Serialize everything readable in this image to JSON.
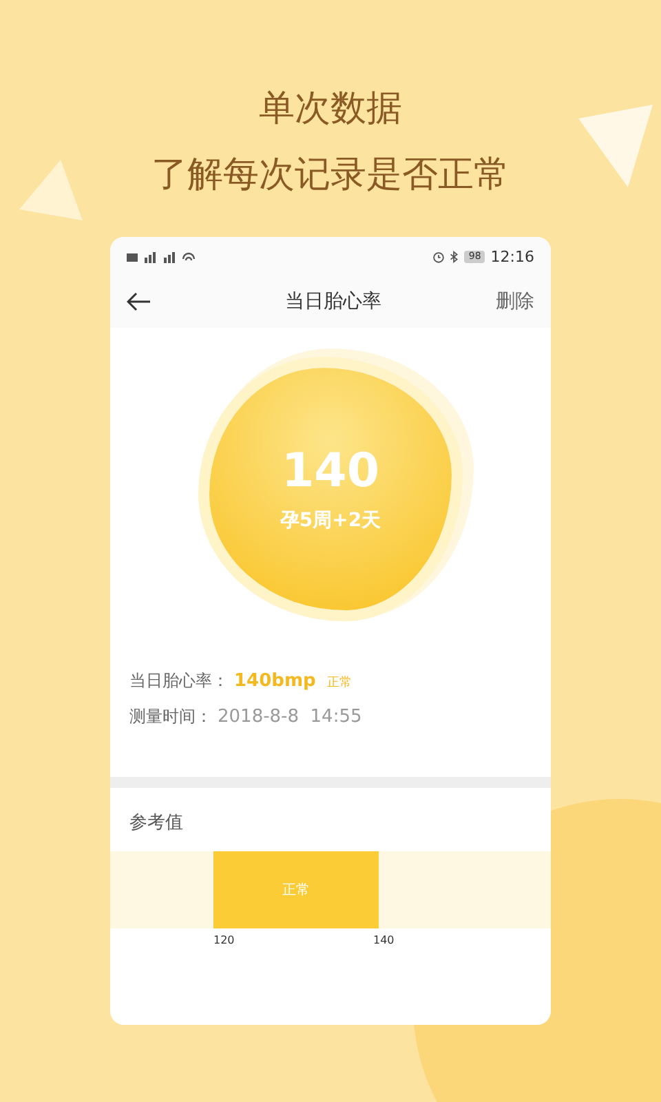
{
  "headline": [
    "单次数据",
    "了解每次记录是否正常"
  ],
  "status_bar": {
    "battery": "98",
    "time": "12:16"
  },
  "nav": {
    "title": "当日胎心率",
    "action": "删除"
  },
  "reading": {
    "value": "140",
    "gestation": "孕5周+2天"
  },
  "details": [
    {
      "kind": "rate",
      "label": "当日胎心率：",
      "value": "140bmp",
      "tag": "正常"
    },
    {
      "kind": "time",
      "label": "测量时间：",
      "value": "2018-8-8  14:55"
    }
  ],
  "reference": {
    "title": "参考值",
    "band_label": "正常",
    "ticks": [
      "120",
      "140"
    ]
  }
}
